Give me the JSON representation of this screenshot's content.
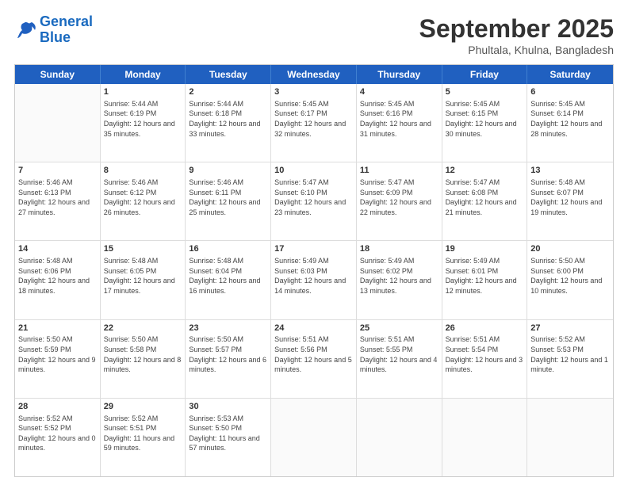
{
  "header": {
    "logo": {
      "line1": "General",
      "line2": "Blue"
    },
    "title": "September 2025",
    "location": "Phultala, Khulna, Bangladesh"
  },
  "calendar": {
    "weekdays": [
      "Sunday",
      "Monday",
      "Tuesday",
      "Wednesday",
      "Thursday",
      "Friday",
      "Saturday"
    ],
    "rows": [
      [
        {
          "day": "",
          "empty": true
        },
        {
          "day": "1",
          "sunrise": "Sunrise: 5:44 AM",
          "sunset": "Sunset: 6:19 PM",
          "daylight": "Daylight: 12 hours and 35 minutes."
        },
        {
          "day": "2",
          "sunrise": "Sunrise: 5:44 AM",
          "sunset": "Sunset: 6:18 PM",
          "daylight": "Daylight: 12 hours and 33 minutes."
        },
        {
          "day": "3",
          "sunrise": "Sunrise: 5:45 AM",
          "sunset": "Sunset: 6:17 PM",
          "daylight": "Daylight: 12 hours and 32 minutes."
        },
        {
          "day": "4",
          "sunrise": "Sunrise: 5:45 AM",
          "sunset": "Sunset: 6:16 PM",
          "daylight": "Daylight: 12 hours and 31 minutes."
        },
        {
          "day": "5",
          "sunrise": "Sunrise: 5:45 AM",
          "sunset": "Sunset: 6:15 PM",
          "daylight": "Daylight: 12 hours and 30 minutes."
        },
        {
          "day": "6",
          "sunrise": "Sunrise: 5:45 AM",
          "sunset": "Sunset: 6:14 PM",
          "daylight": "Daylight: 12 hours and 28 minutes."
        }
      ],
      [
        {
          "day": "7",
          "sunrise": "Sunrise: 5:46 AM",
          "sunset": "Sunset: 6:13 PM",
          "daylight": "Daylight: 12 hours and 27 minutes."
        },
        {
          "day": "8",
          "sunrise": "Sunrise: 5:46 AM",
          "sunset": "Sunset: 6:12 PM",
          "daylight": "Daylight: 12 hours and 26 minutes."
        },
        {
          "day": "9",
          "sunrise": "Sunrise: 5:46 AM",
          "sunset": "Sunset: 6:11 PM",
          "daylight": "Daylight: 12 hours and 25 minutes."
        },
        {
          "day": "10",
          "sunrise": "Sunrise: 5:47 AM",
          "sunset": "Sunset: 6:10 PM",
          "daylight": "Daylight: 12 hours and 23 minutes."
        },
        {
          "day": "11",
          "sunrise": "Sunrise: 5:47 AM",
          "sunset": "Sunset: 6:09 PM",
          "daylight": "Daylight: 12 hours and 22 minutes."
        },
        {
          "day": "12",
          "sunrise": "Sunrise: 5:47 AM",
          "sunset": "Sunset: 6:08 PM",
          "daylight": "Daylight: 12 hours and 21 minutes."
        },
        {
          "day": "13",
          "sunrise": "Sunrise: 5:48 AM",
          "sunset": "Sunset: 6:07 PM",
          "daylight": "Daylight: 12 hours and 19 minutes."
        }
      ],
      [
        {
          "day": "14",
          "sunrise": "Sunrise: 5:48 AM",
          "sunset": "Sunset: 6:06 PM",
          "daylight": "Daylight: 12 hours and 18 minutes."
        },
        {
          "day": "15",
          "sunrise": "Sunrise: 5:48 AM",
          "sunset": "Sunset: 6:05 PM",
          "daylight": "Daylight: 12 hours and 17 minutes."
        },
        {
          "day": "16",
          "sunrise": "Sunrise: 5:48 AM",
          "sunset": "Sunset: 6:04 PM",
          "daylight": "Daylight: 12 hours and 16 minutes."
        },
        {
          "day": "17",
          "sunrise": "Sunrise: 5:49 AM",
          "sunset": "Sunset: 6:03 PM",
          "daylight": "Daylight: 12 hours and 14 minutes."
        },
        {
          "day": "18",
          "sunrise": "Sunrise: 5:49 AM",
          "sunset": "Sunset: 6:02 PM",
          "daylight": "Daylight: 12 hours and 13 minutes."
        },
        {
          "day": "19",
          "sunrise": "Sunrise: 5:49 AM",
          "sunset": "Sunset: 6:01 PM",
          "daylight": "Daylight: 12 hours and 12 minutes."
        },
        {
          "day": "20",
          "sunrise": "Sunrise: 5:50 AM",
          "sunset": "Sunset: 6:00 PM",
          "daylight": "Daylight: 12 hours and 10 minutes."
        }
      ],
      [
        {
          "day": "21",
          "sunrise": "Sunrise: 5:50 AM",
          "sunset": "Sunset: 5:59 PM",
          "daylight": "Daylight: 12 hours and 9 minutes."
        },
        {
          "day": "22",
          "sunrise": "Sunrise: 5:50 AM",
          "sunset": "Sunset: 5:58 PM",
          "daylight": "Daylight: 12 hours and 8 minutes."
        },
        {
          "day": "23",
          "sunrise": "Sunrise: 5:50 AM",
          "sunset": "Sunset: 5:57 PM",
          "daylight": "Daylight: 12 hours and 6 minutes."
        },
        {
          "day": "24",
          "sunrise": "Sunrise: 5:51 AM",
          "sunset": "Sunset: 5:56 PM",
          "daylight": "Daylight: 12 hours and 5 minutes."
        },
        {
          "day": "25",
          "sunrise": "Sunrise: 5:51 AM",
          "sunset": "Sunset: 5:55 PM",
          "daylight": "Daylight: 12 hours and 4 minutes."
        },
        {
          "day": "26",
          "sunrise": "Sunrise: 5:51 AM",
          "sunset": "Sunset: 5:54 PM",
          "daylight": "Daylight: 12 hours and 3 minutes."
        },
        {
          "day": "27",
          "sunrise": "Sunrise: 5:52 AM",
          "sunset": "Sunset: 5:53 PM",
          "daylight": "Daylight: 12 hours and 1 minute."
        }
      ],
      [
        {
          "day": "28",
          "sunrise": "Sunrise: 5:52 AM",
          "sunset": "Sunset: 5:52 PM",
          "daylight": "Daylight: 12 hours and 0 minutes."
        },
        {
          "day": "29",
          "sunrise": "Sunrise: 5:52 AM",
          "sunset": "Sunset: 5:51 PM",
          "daylight": "Daylight: 11 hours and 59 minutes."
        },
        {
          "day": "30",
          "sunrise": "Sunrise: 5:53 AM",
          "sunset": "Sunset: 5:50 PM",
          "daylight": "Daylight: 11 hours and 57 minutes."
        },
        {
          "day": "",
          "empty": true
        },
        {
          "day": "",
          "empty": true
        },
        {
          "day": "",
          "empty": true
        },
        {
          "day": "",
          "empty": true
        }
      ]
    ]
  }
}
